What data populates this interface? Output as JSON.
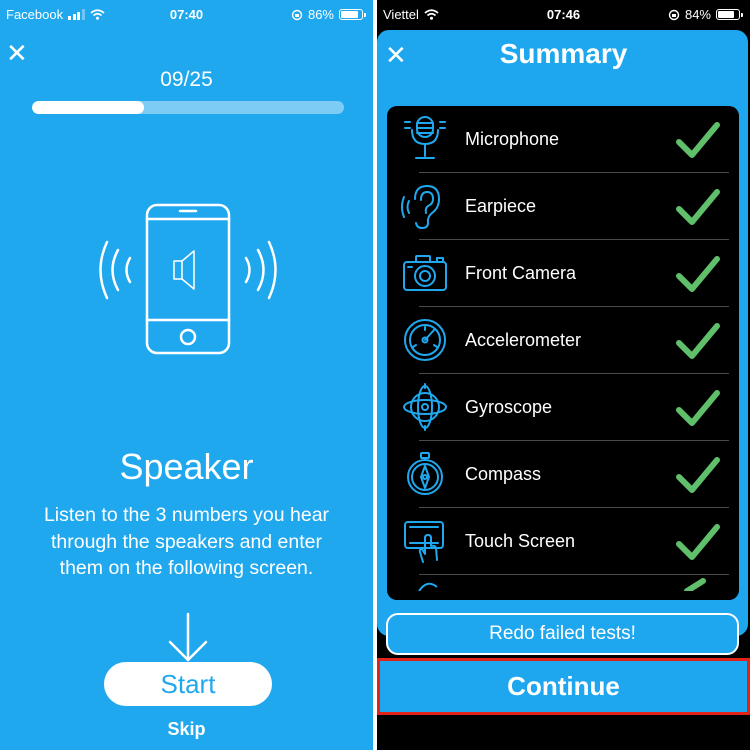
{
  "colors": {
    "accent": "#20a8ef",
    "check_green": "#5fbf6a",
    "highlight_border": "#e2231a"
  },
  "left_screen": {
    "status_bar": {
      "carrier": "Facebook",
      "time": "07:40",
      "battery": "86%"
    },
    "progress": {
      "label": "09/25",
      "fraction": 0.36
    },
    "test_title": "Speaker",
    "description": "Listen to the 3 numbers you hear through the speakers and enter them on the following screen.",
    "start_label": "Start",
    "skip_label": "Skip"
  },
  "right_screen": {
    "status_bar": {
      "carrier": "Viettel",
      "time": "07:46",
      "battery": "84%"
    },
    "title": "Summary",
    "items": [
      {
        "label": "Microphone",
        "icon": "microphone-icon",
        "passed": true
      },
      {
        "label": "Earpiece",
        "icon": "ear-icon",
        "passed": true
      },
      {
        "label": "Front Camera",
        "icon": "camera-icon",
        "passed": true
      },
      {
        "label": "Accelerometer",
        "icon": "gauge-icon",
        "passed": true
      },
      {
        "label": "Gyroscope",
        "icon": "gyroscope-icon",
        "passed": true
      },
      {
        "label": "Compass",
        "icon": "compass-icon",
        "passed": true
      },
      {
        "label": "Touch Screen",
        "icon": "touch-screen-icon",
        "passed": true
      }
    ],
    "redo_label": "Redo failed tests!",
    "continue_label": "Continue"
  }
}
